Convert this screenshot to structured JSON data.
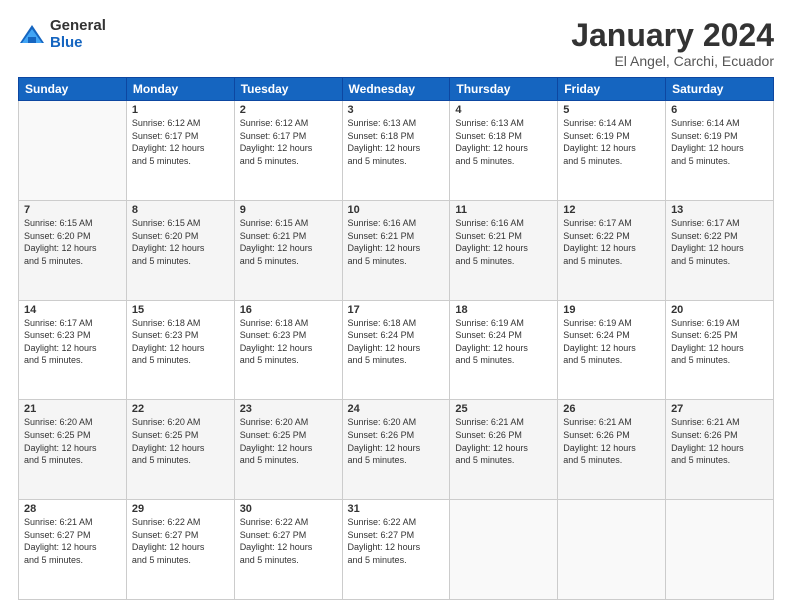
{
  "logo": {
    "general": "General",
    "blue": "Blue"
  },
  "title": "January 2024",
  "location": "El Angel, Carchi, Ecuador",
  "days_header": [
    "Sunday",
    "Monday",
    "Tuesday",
    "Wednesday",
    "Thursday",
    "Friday",
    "Saturday"
  ],
  "weeks": [
    [
      {
        "day": "",
        "info": ""
      },
      {
        "day": "1",
        "info": "Sunrise: 6:12 AM\nSunset: 6:17 PM\nDaylight: 12 hours\nand 5 minutes."
      },
      {
        "day": "2",
        "info": "Sunrise: 6:12 AM\nSunset: 6:17 PM\nDaylight: 12 hours\nand 5 minutes."
      },
      {
        "day": "3",
        "info": "Sunrise: 6:13 AM\nSunset: 6:18 PM\nDaylight: 12 hours\nand 5 minutes."
      },
      {
        "day": "4",
        "info": "Sunrise: 6:13 AM\nSunset: 6:18 PM\nDaylight: 12 hours\nand 5 minutes."
      },
      {
        "day": "5",
        "info": "Sunrise: 6:14 AM\nSunset: 6:19 PM\nDaylight: 12 hours\nand 5 minutes."
      },
      {
        "day": "6",
        "info": "Sunrise: 6:14 AM\nSunset: 6:19 PM\nDaylight: 12 hours\nand 5 minutes."
      }
    ],
    [
      {
        "day": "7",
        "info": "Sunrise: 6:15 AM\nSunset: 6:20 PM\nDaylight: 12 hours\nand 5 minutes."
      },
      {
        "day": "8",
        "info": "Sunrise: 6:15 AM\nSunset: 6:20 PM\nDaylight: 12 hours\nand 5 minutes."
      },
      {
        "day": "9",
        "info": "Sunrise: 6:15 AM\nSunset: 6:21 PM\nDaylight: 12 hours\nand 5 minutes."
      },
      {
        "day": "10",
        "info": "Sunrise: 6:16 AM\nSunset: 6:21 PM\nDaylight: 12 hours\nand 5 minutes."
      },
      {
        "day": "11",
        "info": "Sunrise: 6:16 AM\nSunset: 6:21 PM\nDaylight: 12 hours\nand 5 minutes."
      },
      {
        "day": "12",
        "info": "Sunrise: 6:17 AM\nSunset: 6:22 PM\nDaylight: 12 hours\nand 5 minutes."
      },
      {
        "day": "13",
        "info": "Sunrise: 6:17 AM\nSunset: 6:22 PM\nDaylight: 12 hours\nand 5 minutes."
      }
    ],
    [
      {
        "day": "14",
        "info": "Sunrise: 6:17 AM\nSunset: 6:23 PM\nDaylight: 12 hours\nand 5 minutes."
      },
      {
        "day": "15",
        "info": "Sunrise: 6:18 AM\nSunset: 6:23 PM\nDaylight: 12 hours\nand 5 minutes."
      },
      {
        "day": "16",
        "info": "Sunrise: 6:18 AM\nSunset: 6:23 PM\nDaylight: 12 hours\nand 5 minutes."
      },
      {
        "day": "17",
        "info": "Sunrise: 6:18 AM\nSunset: 6:24 PM\nDaylight: 12 hours\nand 5 minutes."
      },
      {
        "day": "18",
        "info": "Sunrise: 6:19 AM\nSunset: 6:24 PM\nDaylight: 12 hours\nand 5 minutes."
      },
      {
        "day": "19",
        "info": "Sunrise: 6:19 AM\nSunset: 6:24 PM\nDaylight: 12 hours\nand 5 minutes."
      },
      {
        "day": "20",
        "info": "Sunrise: 6:19 AM\nSunset: 6:25 PM\nDaylight: 12 hours\nand 5 minutes."
      }
    ],
    [
      {
        "day": "21",
        "info": "Sunrise: 6:20 AM\nSunset: 6:25 PM\nDaylight: 12 hours\nand 5 minutes."
      },
      {
        "day": "22",
        "info": "Sunrise: 6:20 AM\nSunset: 6:25 PM\nDaylight: 12 hours\nand 5 minutes."
      },
      {
        "day": "23",
        "info": "Sunrise: 6:20 AM\nSunset: 6:25 PM\nDaylight: 12 hours\nand 5 minutes."
      },
      {
        "day": "24",
        "info": "Sunrise: 6:20 AM\nSunset: 6:26 PM\nDaylight: 12 hours\nand 5 minutes."
      },
      {
        "day": "25",
        "info": "Sunrise: 6:21 AM\nSunset: 6:26 PM\nDaylight: 12 hours\nand 5 minutes."
      },
      {
        "day": "26",
        "info": "Sunrise: 6:21 AM\nSunset: 6:26 PM\nDaylight: 12 hours\nand 5 minutes."
      },
      {
        "day": "27",
        "info": "Sunrise: 6:21 AM\nSunset: 6:26 PM\nDaylight: 12 hours\nand 5 minutes."
      }
    ],
    [
      {
        "day": "28",
        "info": "Sunrise: 6:21 AM\nSunset: 6:27 PM\nDaylight: 12 hours\nand 5 minutes."
      },
      {
        "day": "29",
        "info": "Sunrise: 6:22 AM\nSunset: 6:27 PM\nDaylight: 12 hours\nand 5 minutes."
      },
      {
        "day": "30",
        "info": "Sunrise: 6:22 AM\nSunset: 6:27 PM\nDaylight: 12 hours\nand 5 minutes."
      },
      {
        "day": "31",
        "info": "Sunrise: 6:22 AM\nSunset: 6:27 PM\nDaylight: 12 hours\nand 5 minutes."
      },
      {
        "day": "",
        "info": ""
      },
      {
        "day": "",
        "info": ""
      },
      {
        "day": "",
        "info": ""
      }
    ]
  ]
}
